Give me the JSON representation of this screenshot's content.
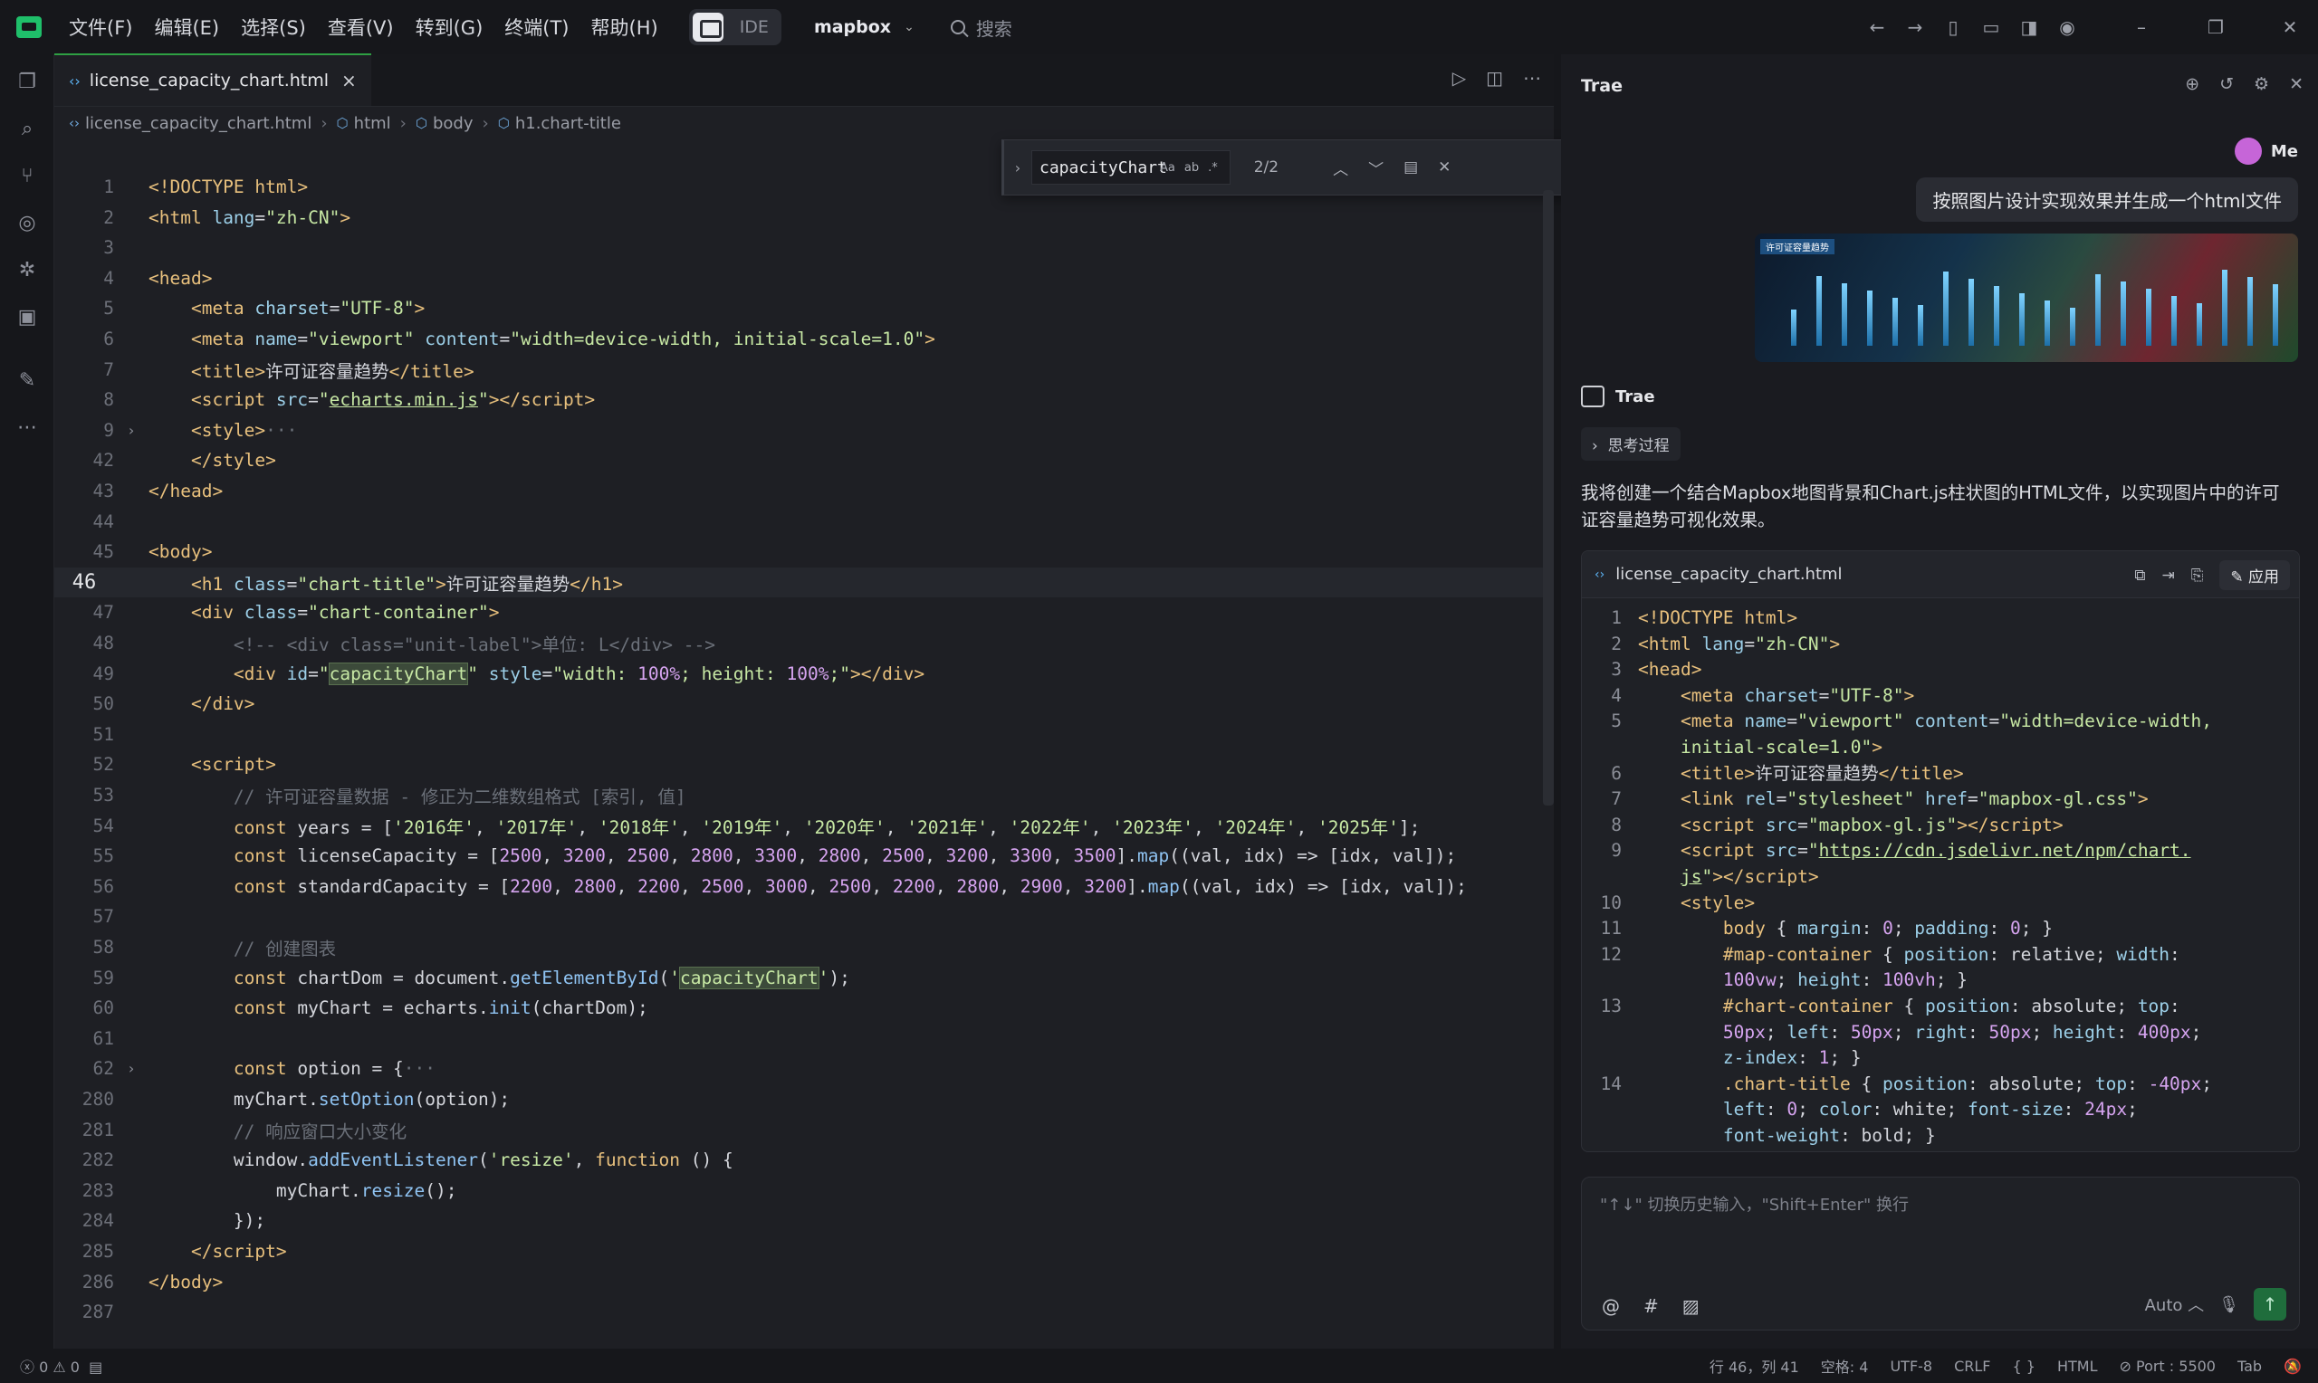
{
  "titlebar": {
    "menus": [
      "文件(F)",
      "编辑(E)",
      "选择(S)",
      "查看(V)",
      "转到(G)",
      "终端(T)",
      "帮助(H)"
    ],
    "ide_label": "IDE",
    "project": "mapbox",
    "search_placeholder": "搜索"
  },
  "editor": {
    "tab_label": "license_capacity_chart.html",
    "breadcrumb": [
      "license_capacity_chart.html",
      "html",
      "body",
      "h1.chart-title"
    ],
    "find": {
      "query": "capacityChart",
      "count": "2/2"
    },
    "lines": [
      {
        "n": "1",
        "html": "<span class='t-tag'>&lt;!DOCTYPE html&gt;</span>"
      },
      {
        "n": "2",
        "html": "<span class='t-tag'>&lt;html</span> <span class='t-attr'>lang</span>=<span class='t-str'>\"zh-CN\"</span><span class='t-tag'>&gt;</span>"
      },
      {
        "n": "3",
        "html": ""
      },
      {
        "n": "4",
        "html": "<span class='t-tag'>&lt;head&gt;</span>"
      },
      {
        "n": "5",
        "html": "    <span class='t-tag'>&lt;meta</span> <span class='t-attr'>charset</span>=<span class='t-str'>\"UTF-8\"</span><span class='t-tag'>&gt;</span>"
      },
      {
        "n": "6",
        "html": "    <span class='t-tag'>&lt;meta</span> <span class='t-attr'>name</span>=<span class='t-str'>\"viewport\"</span> <span class='t-attr'>content</span>=<span class='t-str'>\"width=device-width, initial-scale=1.0\"</span><span class='t-tag'>&gt;</span>"
      },
      {
        "n": "7",
        "html": "    <span class='t-tag'>&lt;title&gt;</span>许可证容量趋势<span class='t-tag'>&lt;/title&gt;</span>"
      },
      {
        "n": "8",
        "html": "    <span class='t-tag'>&lt;script</span> <span class='t-attr'>src</span>=<span class='t-str'>\"<u>echarts.min.js</u>\"</span><span class='t-tag'>&gt;&lt;/script&gt;</span>"
      },
      {
        "n": "9",
        "fold": "›",
        "html": "    <span class='t-tag'>&lt;style&gt;</span><span class='t-cm'>···</span>"
      },
      {
        "n": "42",
        "html": "    <span class='t-tag'>&lt;/style&gt;</span>"
      },
      {
        "n": "43",
        "html": "<span class='t-tag'>&lt;/head&gt;</span>"
      },
      {
        "n": "44",
        "html": ""
      },
      {
        "n": "45",
        "html": "<span class='t-tag'>&lt;body&gt;</span>"
      },
      {
        "n": "46",
        "cur": true,
        "html": "    <span class='t-tag'>&lt;h1</span> <span class='t-attr'>class</span>=<span class='t-str'>\"chart-title\"</span><span class='t-tag'>&gt;</span>许可证容量趋势<span class='t-tag'>&lt;/h1&gt;</span>"
      },
      {
        "n": "47",
        "html": "    <span class='t-tag'>&lt;div</span> <span class='t-attr'>class</span>=<span class='t-str'>\"chart-container\"</span><span class='t-tag'>&gt;</span>"
      },
      {
        "n": "48",
        "html": "        <span class='t-cm'>&lt;!-- &lt;div class=\"unit-label\"&gt;单位: L&lt;/div&gt; --&gt;</span>"
      },
      {
        "n": "49",
        "html": "        <span class='t-tag'>&lt;div</span> <span class='t-attr'>id</span>=<span class='t-str'>\"<span class='t-hl'>capacityChart</span>\"</span> <span class='t-attr'>style</span>=<span class='t-str'>\"width: <span class='t-num'>100%</span>; height: <span class='t-num'>100%</span>;\"</span><span class='t-tag'>&gt;&lt;/div&gt;</span>"
      },
      {
        "n": "50",
        "html": "    <span class='t-tag'>&lt;/div&gt;</span>"
      },
      {
        "n": "51",
        "html": ""
      },
      {
        "n": "52",
        "html": "    <span class='t-tag'>&lt;script&gt;</span>"
      },
      {
        "n": "53",
        "html": "        <span class='t-cm'>// 许可证容量数据 - 修正为二维数组格式 [索引, 值]</span>"
      },
      {
        "n": "54",
        "html": "        <span class='t-kw'>const</span> years = [<span class='t-str'>'2016年'</span>, <span class='t-str'>'2017年'</span>, <span class='t-str'>'2018年'</span>, <span class='t-str'>'2019年'</span>, <span class='t-str'>'2020年'</span>, <span class='t-str'>'2021年'</span>, <span class='t-str'>'2022年'</span>, <span class='t-str'>'2023年'</span>, <span class='t-str'>'2024年'</span>, <span class='t-str'>'2025年'</span>];"
      },
      {
        "n": "55",
        "html": "        <span class='t-kw'>const</span> licenseCapacity = [<span class='t-num'>2500</span>, <span class='t-num'>3200</span>, <span class='t-num'>2500</span>, <span class='t-num'>2800</span>, <span class='t-num'>3300</span>, <span class='t-num'>2800</span>, <span class='t-num'>2500</span>, <span class='t-num'>3200</span>, <span class='t-num'>3300</span>, <span class='t-num'>3500</span>].<span class='t-fn'>map</span>((val, idx) =&gt; [idx, val]);"
      },
      {
        "n": "56",
        "html": "        <span class='t-kw'>const</span> standardCapacity = [<span class='t-num'>2200</span>, <span class='t-num'>2800</span>, <span class='t-num'>2200</span>, <span class='t-num'>2500</span>, <span class='t-num'>3000</span>, <span class='t-num'>2500</span>, <span class='t-num'>2200</span>, <span class='t-num'>2800</span>, <span class='t-num'>2900</span>, <span class='t-num'>3200</span>].<span class='t-fn'>map</span>((val, idx) =&gt; [idx, val]);"
      },
      {
        "n": "57",
        "html": ""
      },
      {
        "n": "58",
        "html": "        <span class='t-cm'>// 创建图表</span>"
      },
      {
        "n": "59",
        "html": "        <span class='t-kw'>const</span> chartDom = document.<span class='t-fn'>getElementById</span>(<span class='t-str'>'<span class='t-hl'>capacityChart</span>'</span>);"
      },
      {
        "n": "60",
        "html": "        <span class='t-kw'>const</span> myChart = echarts.<span class='t-fn'>init</span>(chartDom);"
      },
      {
        "n": "61",
        "html": ""
      },
      {
        "n": "62",
        "fold": "›",
        "html": "        <span class='t-kw'>const</span> option = {<span class='t-cm'>···</span>"
      },
      {
        "n": "280",
        "html": "        myChart.<span class='t-fn'>setOption</span>(option);"
      },
      {
        "n": "281",
        "html": "        <span class='t-cm'>// 响应窗口大小变化</span>"
      },
      {
        "n": "282",
        "html": "        window.<span class='t-fn'>addEventListener</span>(<span class='t-str'>'resize'</span>, <span class='t-kw'>function</span> () {"
      },
      {
        "n": "283",
        "html": "            myChart.<span class='t-fn'>resize</span>();"
      },
      {
        "n": "284",
        "html": "        });"
      },
      {
        "n": "285",
        "html": "    <span class='t-tag'>&lt;/script&gt;</span>"
      },
      {
        "n": "286",
        "html": "<span class='t-tag'>&lt;/body&gt;</span>"
      },
      {
        "n": "287",
        "html": ""
      }
    ]
  },
  "panel": {
    "title": "Trae",
    "user": "Me",
    "user_message": "按照图片设计实现效果并生成一个html文件",
    "thumb_title": "许可证容量趋势",
    "assistant_name": "Trae",
    "thinking_label": "思考过程",
    "reply": "我将创建一个结合Mapbox地图背景和Chart.js柱状图的HTML文件，以实现图片中的许可证容量趋势可视化效果。",
    "code_file": "license_capacity_chart.html",
    "apply_label": "应用",
    "code_lines": [
      {
        "n": "1",
        "html": "<span class='t-tag'>&lt;!DOCTYPE html&gt;</span>"
      },
      {
        "n": "2",
        "html": "<span class='t-tag'>&lt;html</span> <span class='t-attr'>lang</span>=<span class='t-str'>\"zh-CN\"</span><span class='t-tag'>&gt;</span>"
      },
      {
        "n": "3",
        "html": "<span class='t-tag'>&lt;head&gt;</span>"
      },
      {
        "n": "4",
        "html": "    <span class='t-tag'>&lt;meta</span> <span class='t-attr'>charset</span>=<span class='t-str'>\"UTF-8\"</span><span class='t-tag'>&gt;</span>"
      },
      {
        "n": "5",
        "html": "    <span class='t-tag'>&lt;meta</span> <span class='t-attr'>name</span>=<span class='t-str'>\"viewport\"</span> <span class='t-attr'>content</span>=<span class='t-str'>\"width=device-width,</span>"
      },
      {
        "n": "",
        "html": "    <span class='t-str'>initial-scale=1.0\"</span><span class='t-tag'>&gt;</span>"
      },
      {
        "n": "6",
        "html": "    <span class='t-tag'>&lt;title&gt;</span>许可证容量趋势<span class='t-tag'>&lt;/title&gt;</span>"
      },
      {
        "n": "7",
        "html": "    <span class='t-tag'>&lt;link</span> <span class='t-attr'>rel</span>=<span class='t-str'>\"stylesheet\"</span> <span class='t-attr'>href</span>=<span class='t-str'>\"mapbox-gl.css\"</span><span class='t-tag'>&gt;</span>"
      },
      {
        "n": "8",
        "html": "    <span class='t-tag'>&lt;script</span> <span class='t-attr'>src</span>=<span class='t-str'>\"mapbox-gl.js\"</span><span class='t-tag'>&gt;&lt;/script&gt;</span>"
      },
      {
        "n": "9",
        "html": "    <span class='t-tag'>&lt;script</span> <span class='t-attr'>src</span>=<span class='t-str'>\"<u>https://cdn.jsdelivr.net/npm/chart.</u></span>"
      },
      {
        "n": "",
        "html": "    <span class='t-str'><u>js</u>\"</span><span class='t-tag'>&gt;&lt;/script&gt;</span>"
      },
      {
        "n": "10",
        "html": "    <span class='t-tag'>&lt;style&gt;</span>"
      },
      {
        "n": "11",
        "html": "        <span class='t-tag'>body</span> { <span class='t-attr'>margin</span>: <span class='t-num'>0</span>; <span class='t-attr'>padding</span>: <span class='t-num'>0</span>; }"
      },
      {
        "n": "12",
        "html": "        <span class='t-tag'>#map-container</span> { <span class='t-attr'>position</span>: relative; <span class='t-attr'>width</span>:"
      },
      {
        "n": "",
        "html": "        <span class='t-num'>100vw</span>; <span class='t-attr'>height</span>: <span class='t-num'>100vh</span>; }"
      },
      {
        "n": "13",
        "html": "        <span class='t-tag'>#chart-container</span> { <span class='t-attr'>position</span>: absolute; <span class='t-attr'>top</span>:"
      },
      {
        "n": "",
        "html": "        <span class='t-num'>50px</span>; <span class='t-attr'>left</span>: <span class='t-num'>50px</span>; <span class='t-attr'>right</span>: <span class='t-num'>50px</span>; <span class='t-attr'>height</span>: <span class='t-num'>400px</span>;"
      },
      {
        "n": "",
        "html": "        <span class='t-attr'>z-index</span>: <span class='t-num'>1</span>; }"
      },
      {
        "n": "14",
        "html": "        <span class='t-tag'>.chart-title</span> { <span class='t-attr'>position</span>: absolute; <span class='t-attr'>top</span>: <span class='t-num'>-40px</span>;"
      },
      {
        "n": "",
        "html": "        <span class='t-attr'>left</span>: <span class='t-num'>0</span>; <span class='t-attr'>color</span>: white; <span class='t-attr'>font-size</span>: <span class='t-num'>24px</span>;"
      },
      {
        "n": "",
        "html": "        <span class='t-attr'>font-weight</span>: bold; }"
      }
    ],
    "input_placeholder": "\"↑↓\" 切换历史输入，\"Shift+Enter\" 换行",
    "mode_label": "Auto"
  },
  "status": {
    "errors": "0",
    "warnings": "0",
    "position": "行 46，列 41",
    "spaces": "空格: 4",
    "encoding": "UTF-8",
    "eol": "CRLF",
    "language": "HTML",
    "port": "Port : 5500",
    "tab": "Tab"
  }
}
